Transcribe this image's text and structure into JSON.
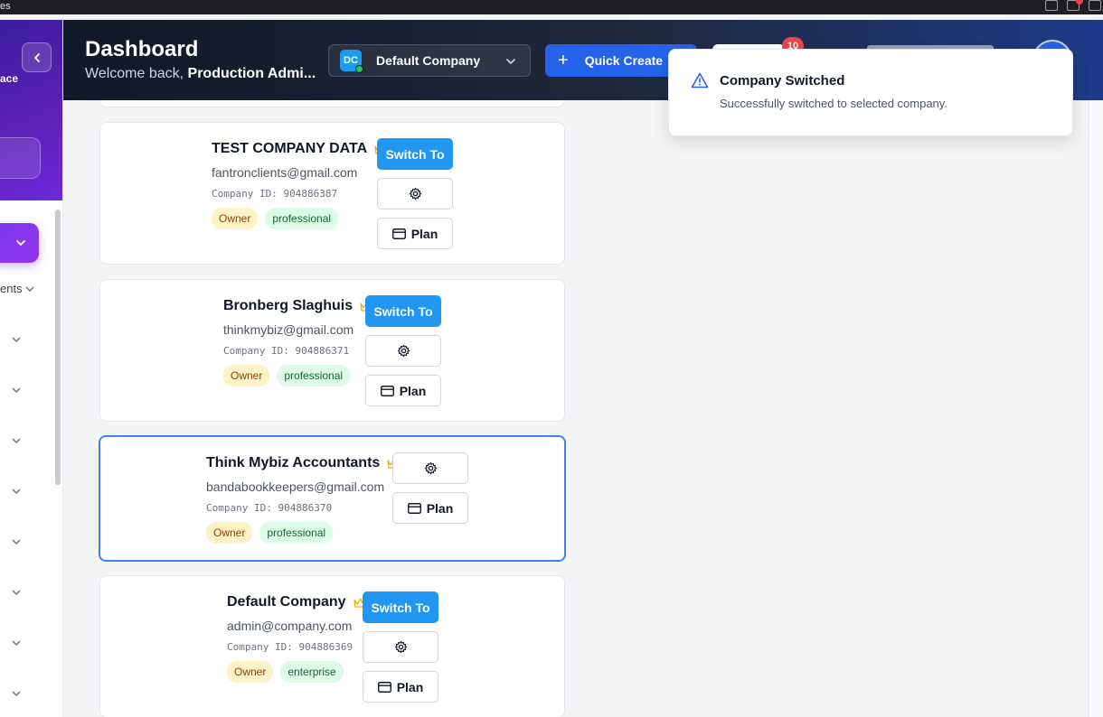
{
  "browser": {
    "partial_label": "es"
  },
  "sidebar": {
    "partial_label_ace": "ace",
    "partial_label_ents": "ents"
  },
  "header": {
    "title": "Dashboard",
    "welcome_prefix": "Welcome back, ",
    "welcome_name": "Production Admi...",
    "company_selector": {
      "initials": "DC",
      "name": "Default Company"
    },
    "quick_create_label": "Quick Create",
    "notification_count": "10"
  },
  "companies": [
    {
      "name": "TEST COMPANY DATA",
      "email": "fantronclients@gmail.com",
      "company_id": "Company ID: 904886387",
      "role": "Owner",
      "plan": "professional",
      "switch_label": "Switch To",
      "plan_button": "Plan"
    },
    {
      "name": "Bronberg Slaghuis",
      "email": "thinkmybiz@gmail.com",
      "company_id": "Company ID: 904886371",
      "role": "Owner",
      "plan": "professional",
      "switch_label": "Switch To",
      "plan_button": "Plan"
    },
    {
      "name": "Think Mybiz Accountants",
      "email": "bandabookkeepers@gmail.com",
      "company_id": "Company ID: 904886370",
      "role": "Owner",
      "plan": "professional",
      "plan_button": "Plan"
    },
    {
      "name": "Default Company",
      "email": "admin@company.com",
      "company_id": "Company ID: 904886369",
      "role": "Owner",
      "plan": "enterprise",
      "switch_label": "Switch To",
      "plan_button": "Plan"
    }
  ],
  "toast": {
    "title": "Company Switched",
    "message": "Successfully switched to selected company."
  },
  "colors": {
    "primary": "#2196f3",
    "accent": "#7c3aed",
    "owner_badge": "#fef3c7",
    "plan_badge": "#dcfce7",
    "crown": "#eab308"
  }
}
